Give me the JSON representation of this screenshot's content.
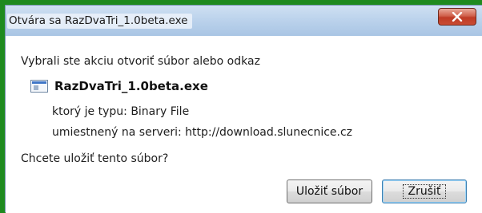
{
  "window": {
    "title": "Otvára sa RazDvaTri_1.0beta.exe"
  },
  "dialog": {
    "heading": "Vybrali ste akciu otvoriť súbor alebo odkaz",
    "file_name": "RazDvaTri_1.0beta.exe",
    "type_label": "ktorý je typu:",
    "type_value": "Binary File",
    "server_label": "umiestnený na serveri:",
    "server_value": "http://download.slunecnice.cz",
    "question": "Chcete uložiť tento súbor?"
  },
  "buttons": {
    "save": "Uložiť súbor",
    "cancel": "Zrušiť"
  },
  "colors": {
    "background_green": "#1f8a1f",
    "close_red": "#c94c33",
    "titlebar": "#bcd3ec"
  },
  "icons": {
    "close": "close-icon",
    "file": "executable-file-icon"
  }
}
